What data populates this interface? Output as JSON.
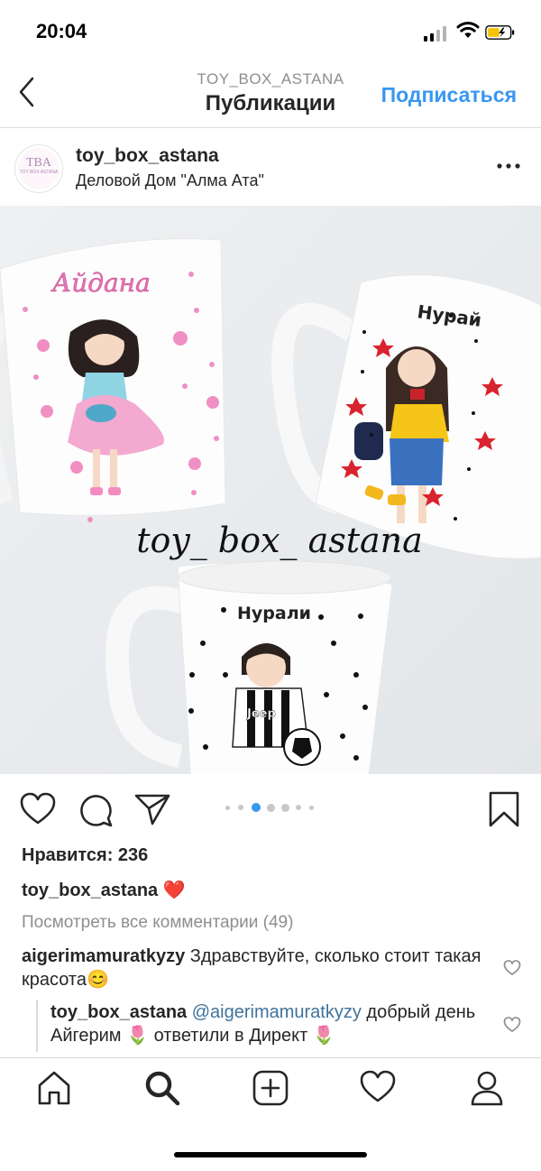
{
  "status_bar": {
    "time": "20:04"
  },
  "header": {
    "subtitle": "TOY_BOX_ASTANA",
    "title": "Публикации",
    "follow_label": "Подписаться"
  },
  "post": {
    "avatar_text": "TBA",
    "avatar_subtext": "TOY BOX ASTANA",
    "username": "toy_box_astana",
    "location": "Деловой Дом \"Алма Ата\"",
    "image": {
      "watermark": "toy_ box_ astana",
      "mug_names": [
        "Айдана",
        "Нурай",
        "Нурали"
      ],
      "shirt_text": "Jeep"
    },
    "carousel": {
      "count": 6,
      "active_index": 1
    },
    "likes": "Нравится: 236",
    "caption_user": "toy_box_astana",
    "caption_emoji": "❤️",
    "view_all_comments": "Посмотреть все комментарии (49)",
    "comments": [
      {
        "user": "aigerimamuratkyzy",
        "text": "Здравствуйте, сколько стоит такая красота",
        "emoji": "😊"
      },
      {
        "user": "toy_box_astana",
        "mention": "@aigerimamuratkyzy",
        "text_1": "добрый день Айгерим",
        "text_2": "ответили в Директ",
        "emoji": "🌷"
      }
    ]
  },
  "icons": {
    "like": "heart-icon",
    "comment": "comment-icon",
    "share": "send-icon",
    "save": "bookmark-icon",
    "nav": [
      "home-icon",
      "search-icon",
      "add-post-icon",
      "activity-heart-icon",
      "profile-icon"
    ]
  },
  "colors": {
    "link_blue": "#3897f0",
    "mention_blue": "#3f729b",
    "muted": "#8e8e8e",
    "heart_red": "#e0245e"
  }
}
